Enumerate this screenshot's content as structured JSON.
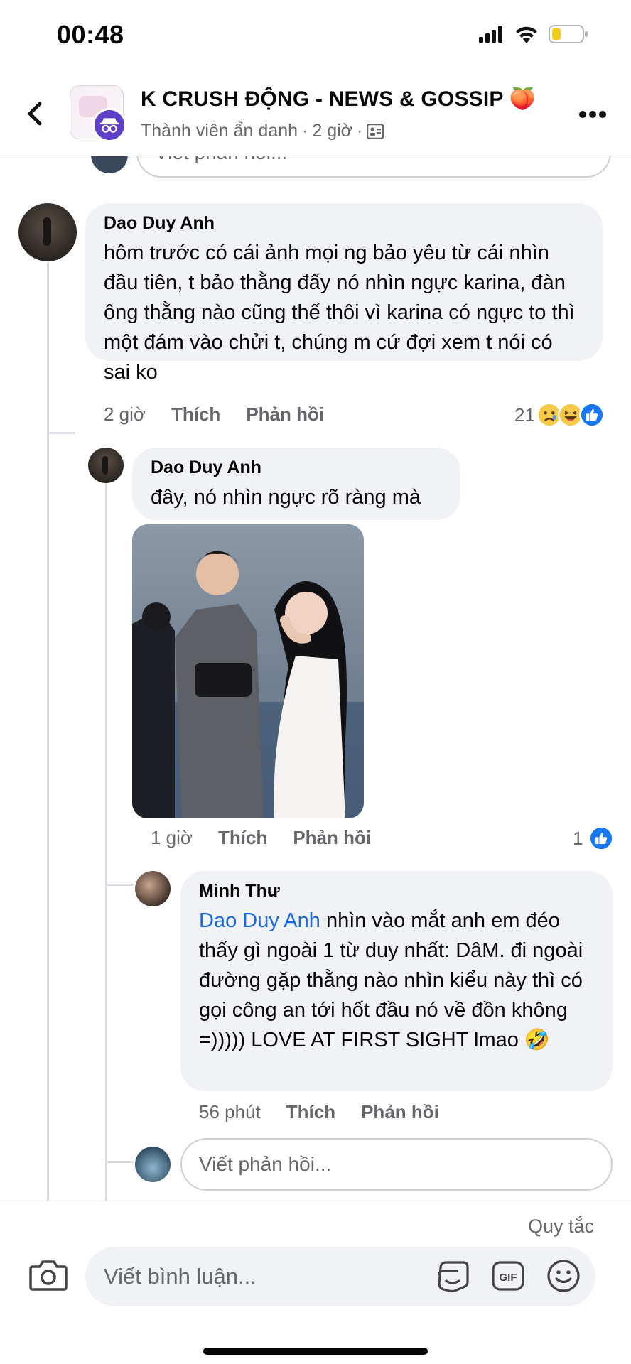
{
  "status": {
    "time": "00:48"
  },
  "header": {
    "title": "K CRUSH ĐỘNG - NEWS & GOSSIP 🍑",
    "subtitle_author": "Thành viên ẩn danh",
    "subtitle_sep": "·",
    "subtitle_time": "2 giờ",
    "subtitle_sep2": "·"
  },
  "top_reply": {
    "placeholder": "Viết phản hồi..."
  },
  "comments": [
    {
      "author": "Dao Duy Anh",
      "text": "hôm trước có cái ảnh mọi ng bảo yêu từ cái nhìn đầu tiên, t bảo thằng đấy nó nhìn ngực karina, đàn ông thằng nào cũng thế thôi vì karina có ngực to thì một đám vào chửi t, chúng m cứ đợi xem t nói có sai ko",
      "time": "2 giờ",
      "like": "Thích",
      "reply": "Phản hồi",
      "reaction_count": "21",
      "reactions": [
        "sad-icon",
        "haha-icon",
        "like-icon"
      ]
    },
    {
      "author": "Dao Duy Anh",
      "text": "đây, nó nhìn ngực rõ ràng mà",
      "time": "1 giờ",
      "like": "Thích",
      "reply": "Phản hồi",
      "reaction_count": "1",
      "reactions": [
        "like-icon"
      ]
    },
    {
      "author": "Minh Thư",
      "mention": "Dao Duy Anh",
      "text": " nhìn vào mắt anh em đéo thấy gì ngoài 1 từ duy nhất: DâM. đi ngoài đường gặp thằng nào nhìn kiểu này thì có gọi công an tới hốt đầu nó về đồn không =))))) LOVE AT FIRST SIGHT lmao 🤣",
      "time": "56 phút",
      "like": "Thích",
      "reply": "Phản hồi"
    }
  ],
  "reply_input": {
    "placeholder": "Viết phản hồi..."
  },
  "footer": {
    "rules": "Quy tắc",
    "comment_placeholder": "Viết bình luận...",
    "gif_label": "GIF"
  },
  "colors": {
    "accent": "#1877f2",
    "mention": "#1b6ad9",
    "bubble": "#f0f2f5",
    "meta": "#65676b"
  }
}
